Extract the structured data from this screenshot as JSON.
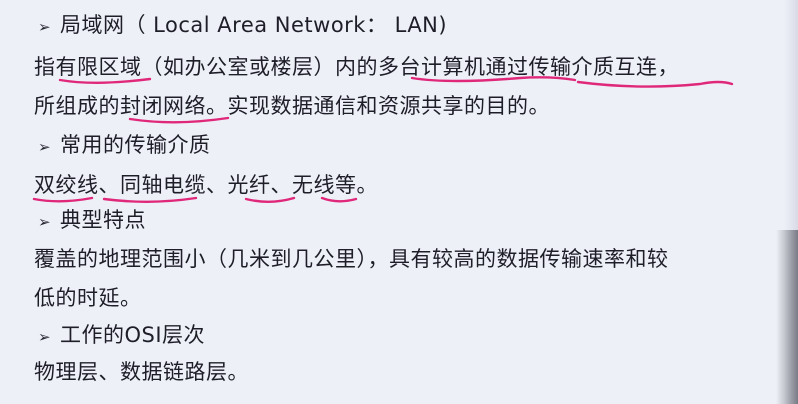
{
  "sections": {
    "lan": {
      "heading": "局域网（ Local Area Network： LAN)",
      "text_line1_seg1": "指",
      "text_line1_seg2": "有限区域",
      "text_line1_seg3": "（如办公室或楼层）内的",
      "text_line1_seg4": "多台计算机",
      "text_line1_seg5": "通过",
      "text_line1_seg6": "传输介质互连",
      "text_line1_seg7": "，",
      "text_line2_seg1": "所组成的",
      "text_line2_seg2": "封闭网络",
      "text_line2_seg3": "。实现数据通信和资源共享的目的。"
    },
    "media": {
      "heading": "常用的传输介质",
      "item1": "双绞线",
      "sep1": "、",
      "item2": "同轴电缆",
      "sep2": "、",
      "item3": "光纤",
      "sep3": "、",
      "item4": "无线",
      "tail": "等。"
    },
    "features": {
      "heading": "典型特点",
      "line1": "覆盖的地理范围小（几米到几公里），具有较高的数据传输速率和较",
      "line2": "低的时延。"
    },
    "osi": {
      "heading": "工作的OSI层次",
      "line1": "物理层、数据链路层。"
    }
  },
  "bullet_glyph": "➢",
  "colors": {
    "annotation": "#e0287a",
    "text": "#1e1e28",
    "background": "#eef0f8"
  }
}
